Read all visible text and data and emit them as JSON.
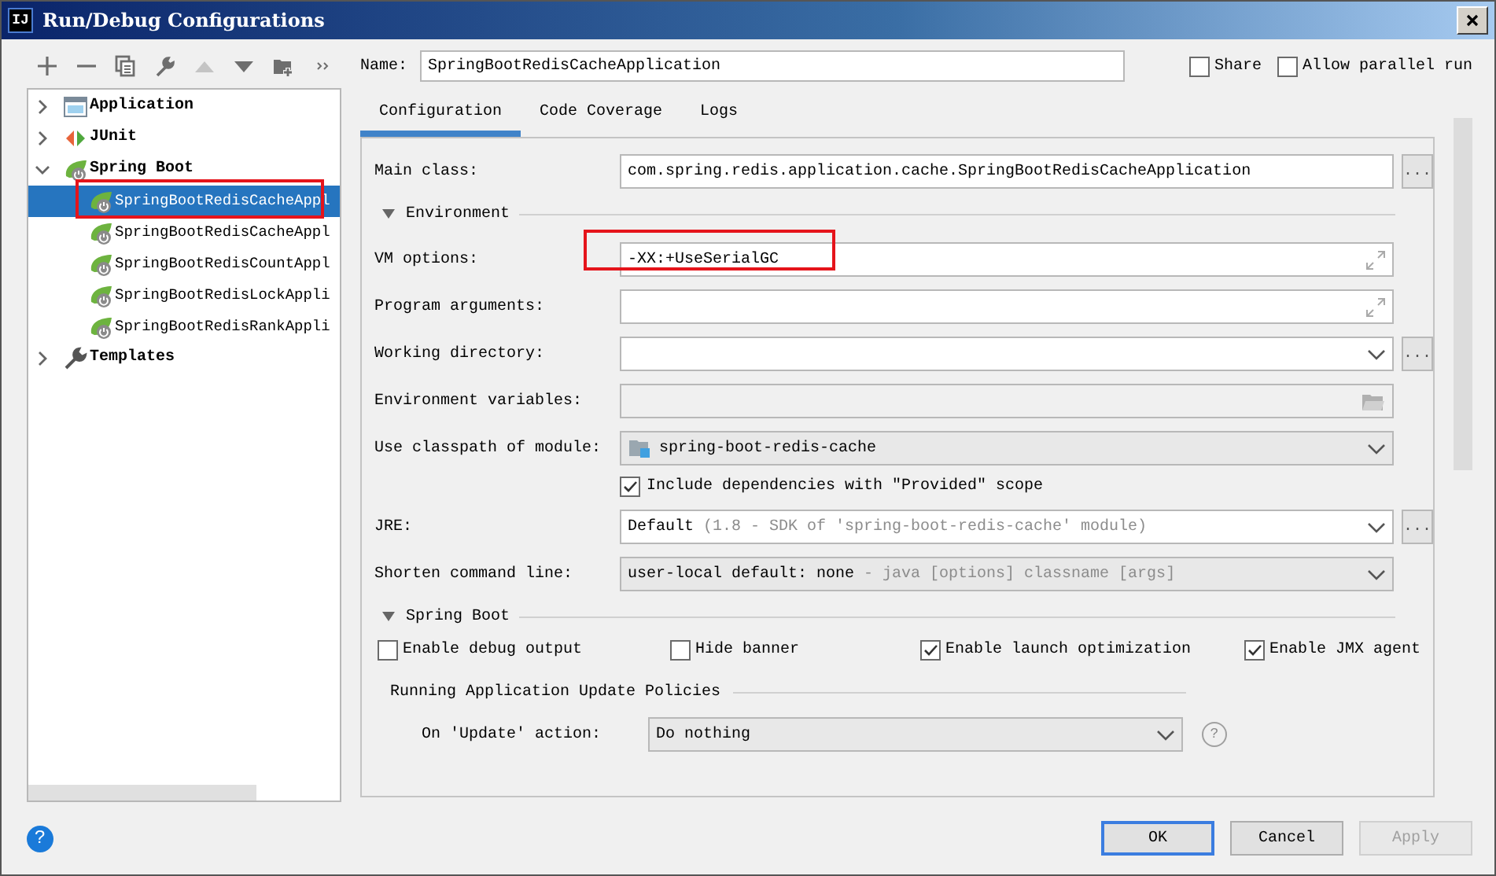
{
  "window": {
    "title": "Run/Debug Configurations",
    "icon_text": "IJ"
  },
  "toolbar": [
    {
      "kind": "add",
      "disabled": false
    },
    {
      "kind": "remove",
      "disabled": false
    },
    {
      "kind": "copy",
      "disabled": false
    },
    {
      "kind": "wrench",
      "disabled": false
    },
    {
      "kind": "up",
      "disabled": true
    },
    {
      "kind": "down",
      "disabled": false
    },
    {
      "kind": "folder",
      "disabled": false
    },
    {
      "kind": "more",
      "disabled": false
    }
  ],
  "tree": [
    {
      "label": "Application",
      "kind": "application",
      "expanded": false
    },
    {
      "label": "JUnit",
      "kind": "junit",
      "expanded": false
    },
    {
      "label": "Spring Boot",
      "kind": "spring",
      "expanded": true,
      "children": [
        {
          "label": "SpringBootRedisCacheAppl",
          "kind": "spring",
          "selected": true,
          "highlighted": true
        },
        {
          "label": "SpringBootRedisCacheAppl",
          "kind": "spring",
          "selected": false,
          "highlighted": false
        },
        {
          "label": "SpringBootRedisCountAppl",
          "kind": "spring",
          "selected": false,
          "highlighted": false
        },
        {
          "label": "SpringBootRedisLockAppli",
          "kind": "spring",
          "selected": false,
          "highlighted": false
        },
        {
          "label": "SpringBootRedisRankAppli",
          "kind": "spring",
          "selected": false,
          "highlighted": false
        }
      ]
    },
    {
      "label": "Templates",
      "kind": "wrench",
      "expanded": false
    }
  ],
  "name_field": {
    "label": "Name:",
    "value": "SpringBootRedisCacheApplication"
  },
  "options": [
    {
      "label": "Share",
      "checked": false
    },
    {
      "label": "Allow parallel run",
      "checked": false
    }
  ],
  "tabs": [
    {
      "label": "Configuration",
      "selected": true
    },
    {
      "label": "Code Coverage",
      "selected": false
    },
    {
      "label": "Logs",
      "selected": false
    }
  ],
  "form": [
    {
      "kind": "field",
      "label": "Main class:",
      "value": "com.spring.redis.application.cache.SpringBootRedisCacheApplication",
      "browse": "..."
    },
    {
      "kind": "section",
      "label": "Environment",
      "expanded": true
    },
    {
      "kind": "field",
      "label": "VM options:",
      "value": "-XX:+UseSerialGC",
      "expand": true,
      "highlighted": true
    },
    {
      "kind": "field",
      "label": "Program arguments:",
      "expand": true
    },
    {
      "kind": "combo",
      "label": "Working directory:",
      "editable": true,
      "browse": "..."
    },
    {
      "kind": "field",
      "label": "Environment variables:",
      "disabled": true,
      "folder": true
    },
    {
      "kind": "combo",
      "label": "Use classpath of module:",
      "value": "spring-boot-redis-cache",
      "editable": false,
      "module_icon": true
    },
    {
      "kind": "checkbox",
      "label": "Include dependencies with \"Provided\" scope",
      "checked": true
    },
    {
      "kind": "combo",
      "label": "JRE:",
      "value": "Default",
      "hint": "(1.8 - SDK of 'spring-boot-redis-cache' module)",
      "editable": true,
      "browse": "..."
    },
    {
      "kind": "combo",
      "label": "Shorten command line:",
      "value": "user-local default: none",
      "hint": "- java [options] classname [args]",
      "editable": false
    },
    {
      "kind": "section",
      "label": "Spring Boot",
      "expanded": true
    },
    {
      "kind": "checks",
      "items": [
        {
          "label": "Enable debug output",
          "checked": false
        },
        {
          "label": "Hide banner",
          "checked": false
        },
        {
          "label": "Enable launch optimization",
          "checked": true
        },
        {
          "label": "Enable JMX agent",
          "checked": true
        }
      ]
    },
    {
      "kind": "subsection",
      "label": "Running Application Update Policies"
    },
    {
      "kind": "combo",
      "label": "On 'Update' action:",
      "value": "Do nothing",
      "editable": false,
      "indent": true,
      "help": "?"
    }
  ],
  "help_button": "?",
  "buttons": [
    {
      "label": "OK",
      "default": true,
      "disabled": false
    },
    {
      "label": "Cancel",
      "default": false,
      "disabled": false
    },
    {
      "label": "Apply",
      "default": false,
      "disabled": true
    }
  ]
}
